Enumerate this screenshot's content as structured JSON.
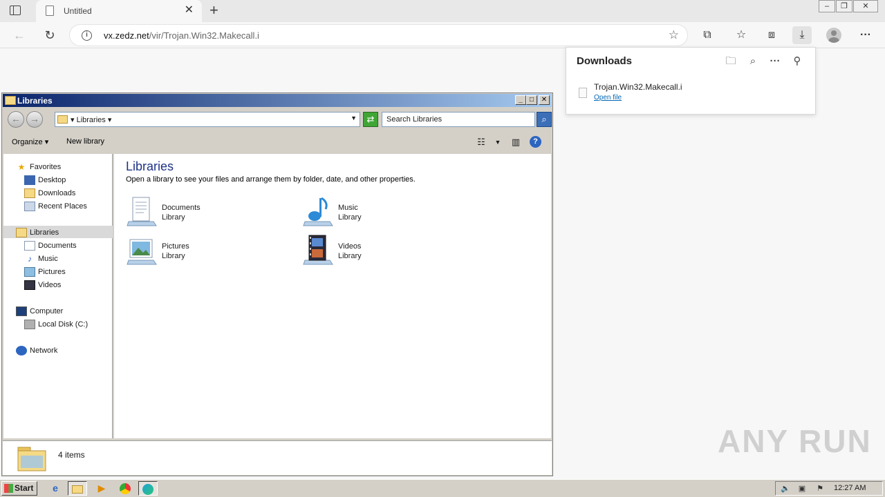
{
  "browser": {
    "tab_title": "Untitled",
    "url_host": "vx.zedz.net",
    "url_path": "/vir/Trojan.Win32.Makecall.i"
  },
  "downloads": {
    "title": "Downloads",
    "file_name": "Trojan.Win32.Makecall.i",
    "open_link": "Open file"
  },
  "explorer": {
    "window_title": "Libraries",
    "breadcrumb": "Libraries",
    "search_placeholder": "Search Libraries",
    "organize_label": "Organize",
    "new_library_label": "New library",
    "nav": {
      "favorites": "Favorites",
      "desktop": "Desktop",
      "downloads": "Downloads",
      "recent_places": "Recent Places",
      "libraries": "Libraries",
      "documents": "Documents",
      "music": "Music",
      "pictures": "Pictures",
      "videos": "Videos",
      "computer": "Computer",
      "local_disk": "Local Disk (C:)",
      "network": "Network"
    },
    "content_title": "Libraries",
    "content_subtitle": "Open a library to see your files and arrange them by folder, date, and other properties.",
    "libraries": [
      {
        "name": "Documents",
        "type": "Library",
        "icon": "documents-icon"
      },
      {
        "name": "Music",
        "type": "Library",
        "icon": "music-icon"
      },
      {
        "name": "Pictures",
        "type": "Library",
        "icon": "pictures-icon"
      },
      {
        "name": "Videos",
        "type": "Library",
        "icon": "videos-icon"
      }
    ],
    "status": "4 items"
  },
  "taskbar": {
    "start_label": "Start",
    "clock": "12:27 AM"
  },
  "watermark": "ANY RUN"
}
